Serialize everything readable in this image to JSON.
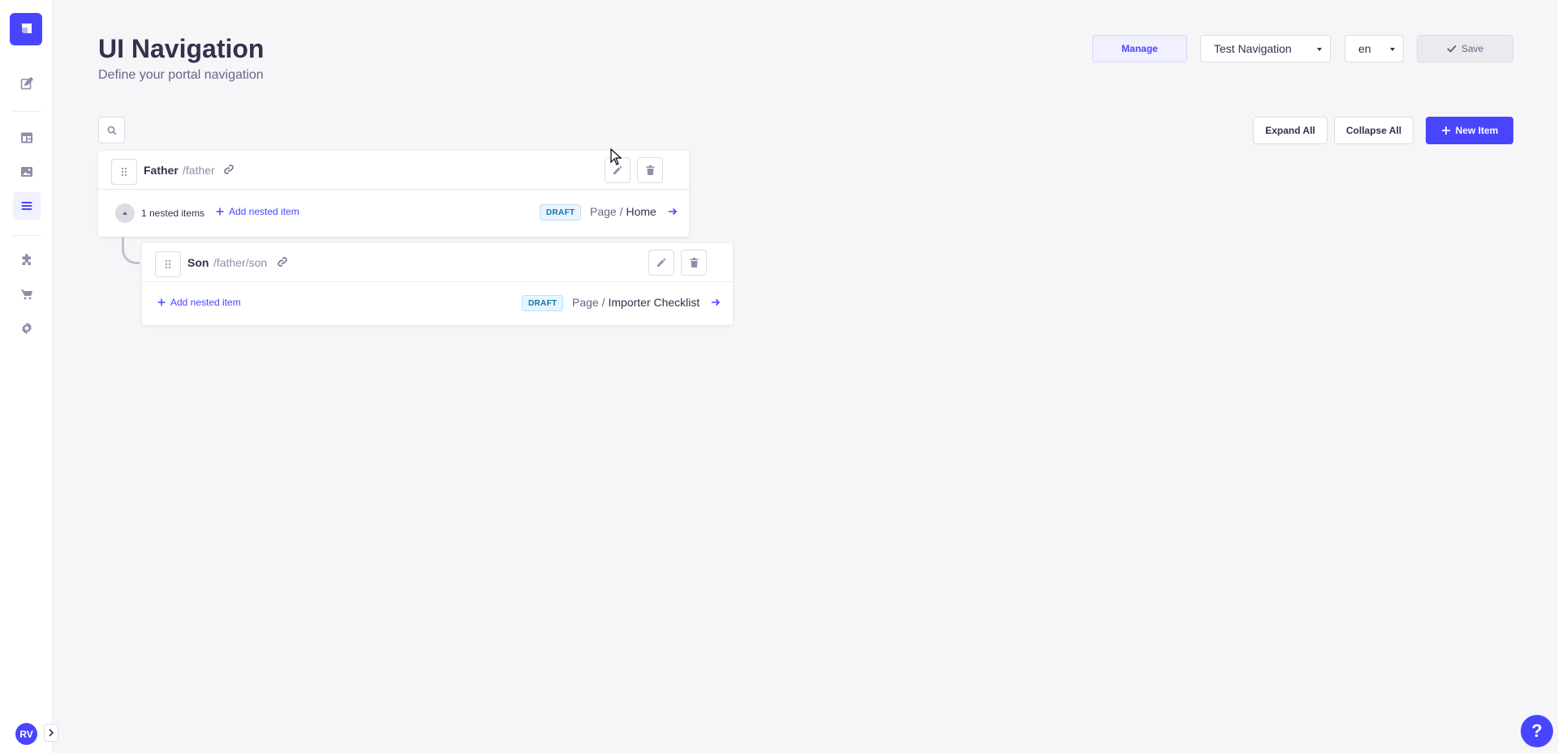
{
  "sidebar": {
    "items": [
      {
        "name": "content-manager",
        "icon": "pencil-square-icon"
      },
      {
        "name": "content-type-builder",
        "icon": "layout-icon"
      },
      {
        "name": "media-library",
        "icon": "image-icon"
      },
      {
        "name": "navigation",
        "icon": "list-icon",
        "active": true
      },
      {
        "name": "plugins",
        "icon": "puzzle-icon"
      },
      {
        "name": "marketplace",
        "icon": "cart-icon"
      },
      {
        "name": "settings",
        "icon": "gear-icon"
      }
    ],
    "avatar_initials": "RV"
  },
  "header": {
    "title": "UI Navigation",
    "subtitle": "Define your portal navigation",
    "manage_label": "Manage",
    "navigation_select": "Test Navigation",
    "locale_select": "en",
    "save_label": "Save"
  },
  "toolbar": {
    "expand_all": "Expand All",
    "collapse_all": "Collapse All",
    "new_item": "New Item"
  },
  "items": [
    {
      "title": "Father",
      "path": "/father",
      "nested_count": "1 nested items",
      "add_nested": "Add nested item",
      "status": "DRAFT",
      "related_prefix": "Page /",
      "related_name": "Home"
    },
    {
      "title": "Son",
      "path": "/father/son",
      "add_nested": "Add nested item",
      "status": "DRAFT",
      "related_prefix": "Page /",
      "related_name": "Importer Checklist"
    }
  ],
  "help_label": "?",
  "colors": {
    "primary": "#4945ff",
    "background": "#f6f6f9",
    "draft_badge": "#0c75af"
  }
}
